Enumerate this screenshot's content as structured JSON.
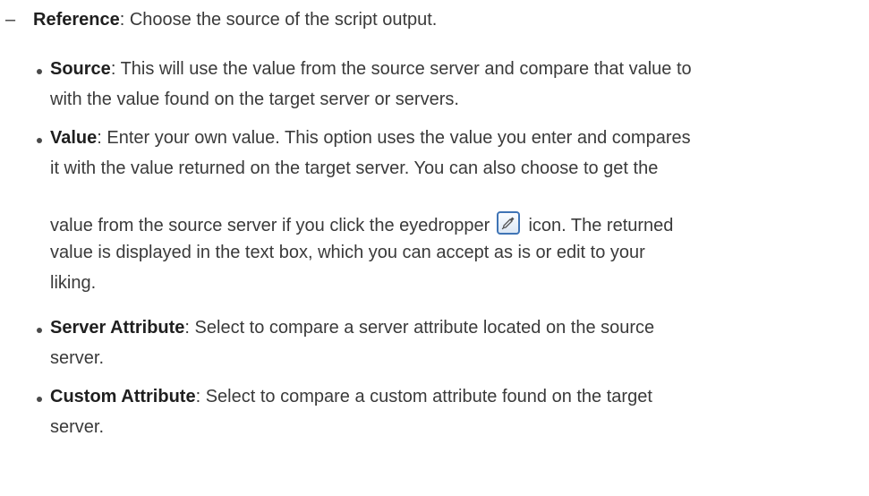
{
  "reference": {
    "dash": "–",
    "label": "Reference",
    "text": ": Choose the source of the script output."
  },
  "options": {
    "source": {
      "label": "Source",
      "line1": ": This will use the value from the source server and compare that value to",
      "line2": "with the value found on the target server or servers."
    },
    "value": {
      "label": "Value",
      "line1": ": Enter your own value. This option uses the value you enter and compares",
      "line2": "it with the value returned on the target server. You can also choose to get the",
      "line3_before_icon": "value from the source server if you click the eyedropper",
      "line3_after_icon": " icon. The returned",
      "line4": "value is displayed in the text box, which you can accept as is or edit to your",
      "line5": "liking.",
      "icon": "eyedropper-icon"
    },
    "server_attribute": {
      "label": "Server Attribute",
      "line1": ": Select to compare a server attribute located on the source",
      "line2": "server."
    },
    "custom_attribute": {
      "label": "Custom Attribute",
      "line1": ": Select to compare a custom attribute found on the target",
      "line2": "server."
    }
  },
  "colors": {
    "text": "#3a3a3a",
    "icon_border": "#3f74b5"
  }
}
